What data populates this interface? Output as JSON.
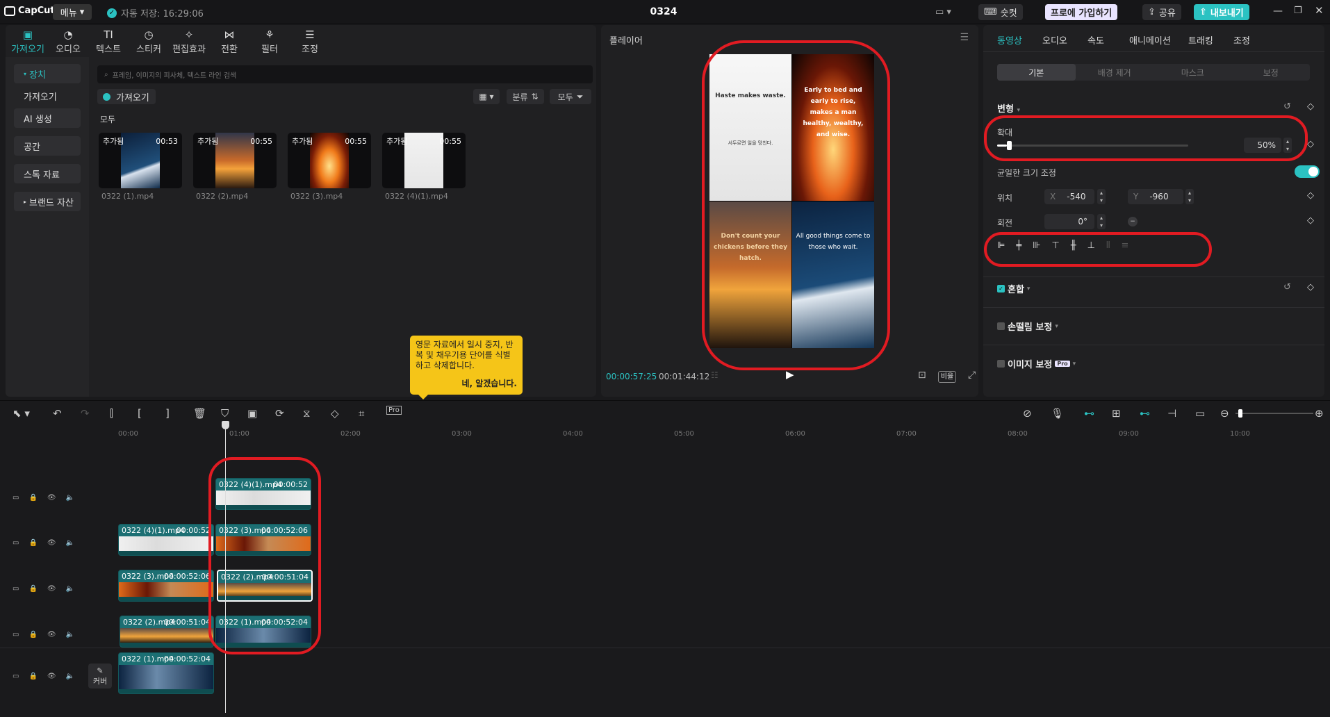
{
  "titlebar": {
    "logo": "CapCut",
    "menu": "메뉴",
    "autosave": "자동 저장: 16:29:06",
    "title": "0324",
    "shortcut": "숏컷",
    "pro": "프로에 가입하기",
    "share": "공유",
    "export": "내보내기"
  },
  "left": {
    "tabs": [
      "가져오기",
      "오디오",
      "텍스트",
      "스티커",
      "편집효과",
      "전환",
      "필터",
      "조정"
    ],
    "nav": [
      "장치",
      "가져오기",
      "AI 생성",
      "공간",
      "스톡 자료",
      "브랜드 자산"
    ],
    "search_placeholder": "프레임, 이미지의 피사체, 텍스트 라인 검색",
    "import_btn": "가져오기",
    "sort": "분류",
    "filter": "모두",
    "section": "모두",
    "media": [
      {
        "tag": "추가됨",
        "dur": "00:53",
        "name": "0322 (1).mp4"
      },
      {
        "tag": "추가됨",
        "dur": "00:55",
        "name": "0322 (2).mp4"
      },
      {
        "tag": "추가됨",
        "dur": "00:55",
        "name": "0322 (3).mp4"
      },
      {
        "tag": "추가됨",
        "dur": "00:55",
        "name": "0322 (4)(1).mp4"
      }
    ],
    "tooltip": {
      "text": "영문 자료에서 일시 중지, 반복 및 채우기용 단어를 식별하고 삭제합니다.",
      "ok": "네, 알겠습니다."
    }
  },
  "player": {
    "title": "플레이어",
    "q1": "Haste makes waste.",
    "q1_sub": "서두르면 일을 망친다.",
    "q2": "Early to bed and early to rise, makes a man healthy, wealthy, and wise.",
    "q3": "Don't count your chickens before they hatch.",
    "q4": "All good things come to those who wait.",
    "current": "00:00:57:25",
    "duration": "00:01:44:12",
    "ratio": "비율"
  },
  "inspector": {
    "tabs": [
      "동영상",
      "오디오",
      "속도",
      "애니메이션",
      "트래킹",
      "조정"
    ],
    "subtabs": [
      "기본",
      "배경 제거",
      "마스크",
      "보정"
    ],
    "transform": "변형",
    "scale_label": "확대",
    "scale_value": "50%",
    "scale_fraction": 0.05,
    "uniform": "균일한 크기 조정",
    "position": "위치",
    "x_label": "X",
    "x_value": "-540",
    "y_label": "Y",
    "y_value": "-960",
    "rotation": "회전",
    "rotation_value": "0°",
    "blend": "혼합",
    "stabilize": "손떨림 보정",
    "enhance": "이미지 보정",
    "pro_badge": "Pro"
  },
  "timeline": {
    "ruler": [
      "00:00",
      "01:00",
      "02:00",
      "03:00",
      "04:00",
      "05:00",
      "06:00",
      "07:00",
      "08:00",
      "09:00",
      "10:00"
    ],
    "cover": "커버",
    "clips": [
      {
        "name": "0322 (4)(1).mp4",
        "dur": "00:00:52"
      },
      {
        "name": "0322 (4)(1).mp4",
        "dur": "00:00:52"
      },
      {
        "name": "0322 (3).mp4",
        "dur": "00:00:52:06"
      },
      {
        "name": "0322 (3).mp4",
        "dur": "00:00:52:06"
      },
      {
        "name": "0322 (2).mp4",
        "dur": "00:00:51:04"
      },
      {
        "name": "0322 (2).mp4",
        "dur": "00:00:51:04"
      },
      {
        "name": "0322 (1).mp4",
        "dur": "00:00:52:04"
      },
      {
        "name": "0322 (1).mp4",
        "dur": "00:00:52:04"
      }
    ]
  },
  "colors": {
    "accent": "#2bc2c2",
    "highlight": "#e11b22",
    "tooltip": "#f5c518",
    "clip": "#1c6f73"
  }
}
